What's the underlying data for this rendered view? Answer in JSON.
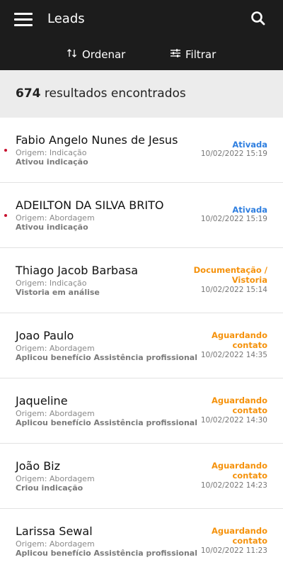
{
  "header": {
    "title": "Leads",
    "sort_label": "Ordenar",
    "filter_label": "Filtrar"
  },
  "results": {
    "count": "674",
    "label": "resultados encontrados"
  },
  "colors": {
    "appbar": "#1c1c1c",
    "status_blue": "#2f7fe0",
    "status_orange": "#f5920c",
    "unread_dot": "#c8102e"
  },
  "leads": [
    {
      "name": "Fabio Angelo Nunes de Jesus",
      "origin": "Origem: Indicação",
      "action": "Ativou indicação",
      "status": "Ativada",
      "date": "10/02/2022 15:19"
    },
    {
      "name": "ADEILTON DA SILVA BRITO",
      "origin": "Origem: Abordagem",
      "action": "Ativou indicação",
      "status": "Ativada",
      "date": "10/02/2022 15:19"
    },
    {
      "name": "Thiago Jacob Barbasa",
      "origin": "Origem: Indicação",
      "action": "Vistoria em análise",
      "status_line1": "Documentação /",
      "status_line2": "Vistoria",
      "date": "10/02/2022 15:14"
    },
    {
      "name": "Joao Paulo",
      "origin": "Origem: Abordagem",
      "action": "Aplicou benefício Assistência profissional",
      "status_line1": "Aguardando",
      "status_line2": "contato",
      "date": "10/02/2022 14:35"
    },
    {
      "name": "Jaqueline",
      "origin": "Origem: Abordagem",
      "action": "Aplicou benefício Assistência profissional",
      "status_line1": "Aguardando",
      "status_line2": "contato",
      "date": "10/02/2022 14:30"
    },
    {
      "name": "João Biz",
      "origin": "Origem: Abordagem",
      "action": "Criou indicação",
      "status_line1": "Aguardando",
      "status_line2": "contato",
      "date": "10/02/2022 14:23"
    },
    {
      "name": "Larissa Sewal",
      "origin": "Origem: Abordagem",
      "action": "Aplicou benefício Assistência profissional",
      "status_line1": "Aguardando",
      "status_line2": "contato",
      "date": "10/02/2022 11:23"
    }
  ]
}
